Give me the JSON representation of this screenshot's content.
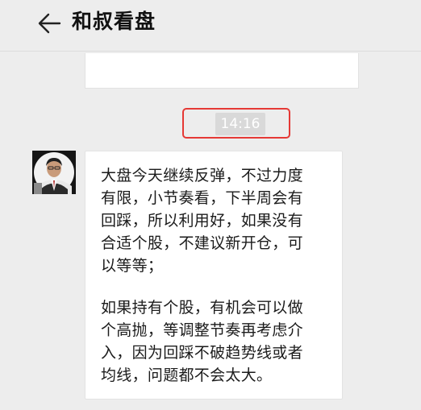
{
  "header": {
    "back_icon": "arrow-left-icon",
    "title": "和叔看盘"
  },
  "chat": {
    "timestamp": "14:16",
    "message": {
      "sender_avatar": "user-avatar",
      "paragraphs": [
        "大盘今天继续反弹，不过力度\n有限，小节奏看，下半周会有\n回踩，所以利用好，如果没有\n合适个股，不建议新开仓，可\n以等等；",
        "如果持有个股，有机会可以做\n个高抛，等调整节奏再考虑介\n入，因为回踩不破趋势线或者\n均线，问题都不会太大。"
      ]
    }
  },
  "colors": {
    "background": "#ededed",
    "bubble": "#ffffff",
    "highlight": "#e53935",
    "timestamp_chip": "#d9d9d9"
  }
}
